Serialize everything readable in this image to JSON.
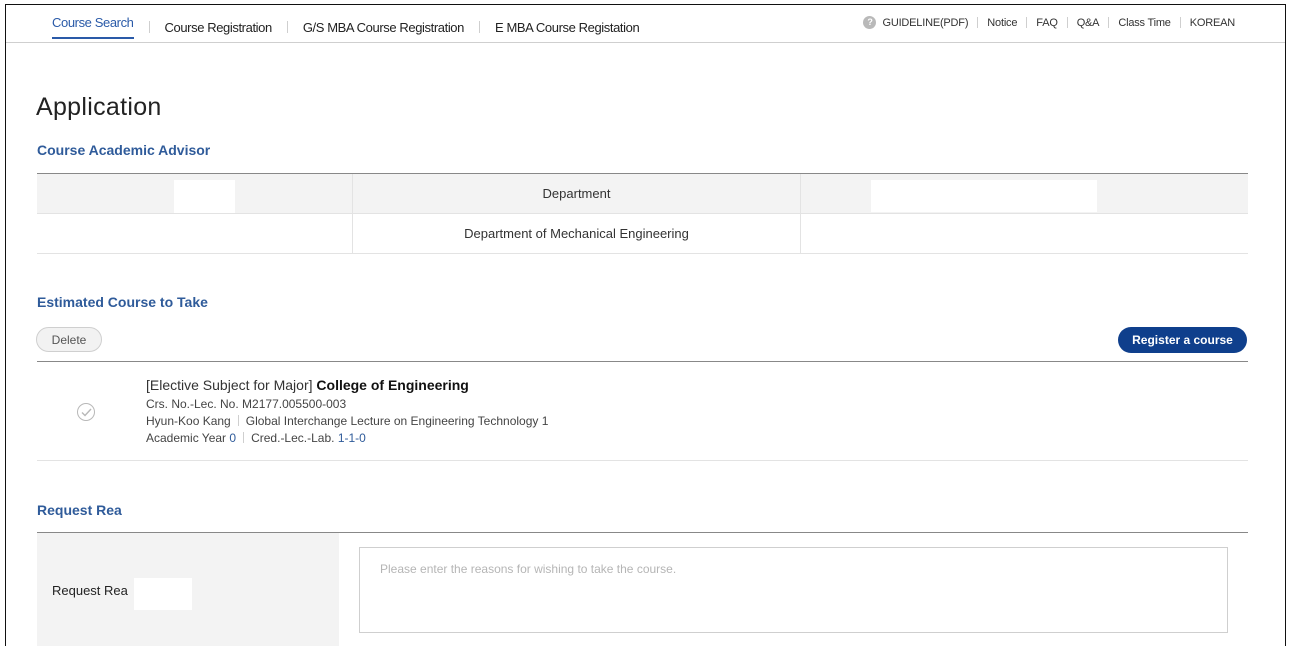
{
  "nav": {
    "tabs": [
      {
        "label": "Course Search"
      },
      {
        "label": "Course Registration"
      },
      {
        "label": "G/S MBA Course Registration"
      },
      {
        "label": "E MBA Course Registation"
      }
    ],
    "links": {
      "guideline": "GUIDELINE(PDF)",
      "notice": "Notice",
      "faq": "FAQ",
      "qa": "Q&A",
      "class_time": "Class Time",
      "korean": "KOREAN"
    }
  },
  "page_title": "Application",
  "advisor": {
    "section_title": "Course Academic Advisor",
    "header": {
      "department": "Department"
    },
    "row": {
      "department": "Department of Mechanical Engineering"
    }
  },
  "estimated": {
    "section_title": "Estimated Course to Take",
    "delete_label": "Delete",
    "register_label": "Register a course",
    "course": {
      "category": "[Elective Subject for Major]",
      "college": "College of Engineering",
      "crs_label": "Crs. No.-Lec. No.",
      "crs_value": "M2177.005500-003",
      "instructor": "Hyun-Koo Kang",
      "title": "Global Interchange Lecture on Engineering Technology 1",
      "year_label": "Academic Year",
      "year_value": "0",
      "credit_label": "Cred.-Lec.-Lab.",
      "credit_value": "1-1-0"
    }
  },
  "request": {
    "section_title": "Request Rea",
    "label": "Request Rea",
    "placeholder": "Please enter the reasons for wishing to take the course."
  },
  "colors": {
    "accent": "#2f5b9a",
    "button_primary": "#0f3f8c"
  }
}
